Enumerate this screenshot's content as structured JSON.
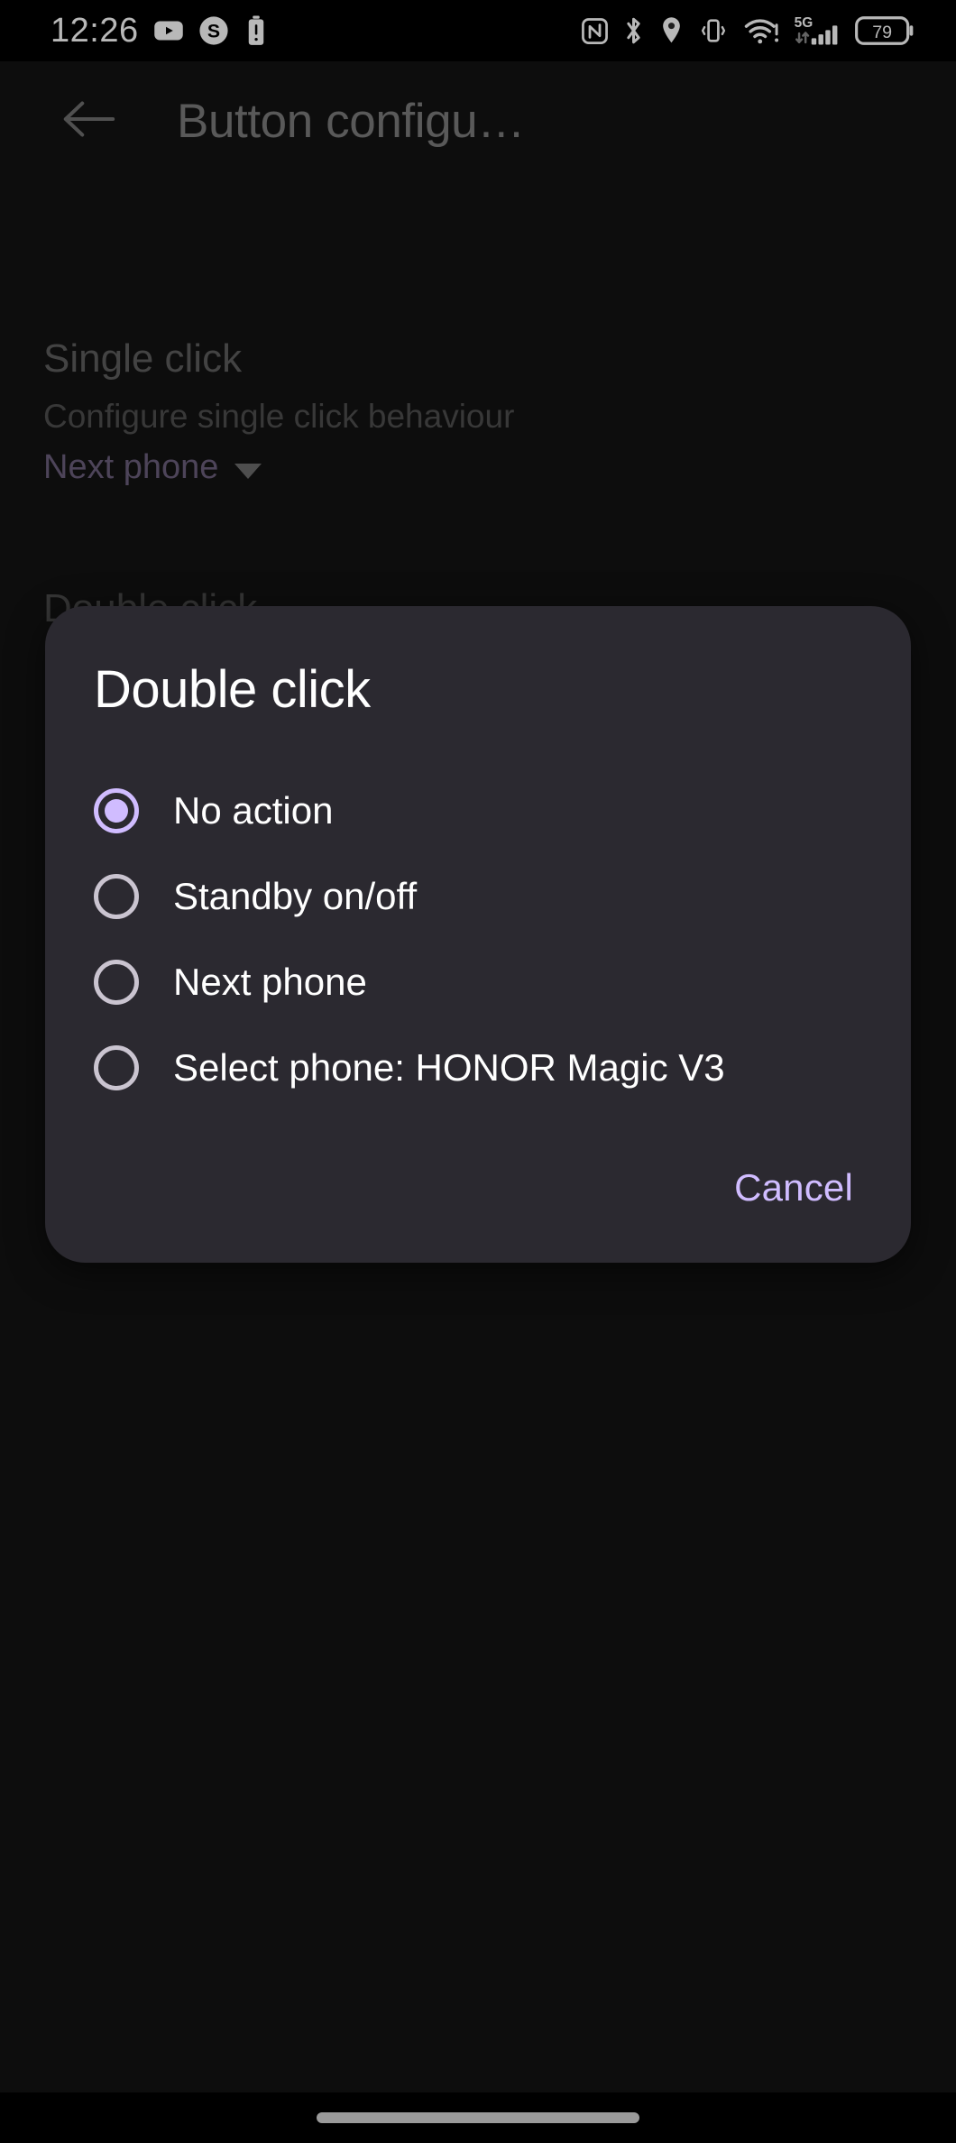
{
  "status_bar": {
    "clock": "12:26",
    "left_icons": [
      "youtube-icon",
      "skype-icon",
      "battery-alert-icon"
    ],
    "right_icons": [
      "nfc-icon",
      "bluetooth-icon",
      "location-icon",
      "vibrate-icon",
      "wifi-alert-icon",
      "mobile-signal-icon"
    ],
    "network_type": "5G",
    "battery_percent": "79"
  },
  "app_bar": {
    "back_label": "back-arrow",
    "title": "Button configu…"
  },
  "page": {
    "sections": [
      {
        "title": "Single click",
        "summary": "Configure single click behaviour",
        "value": "Next phone"
      },
      {
        "title": "Double click"
      }
    ]
  },
  "dialog": {
    "title": "Double click",
    "options": [
      {
        "label": "No action",
        "selected": true
      },
      {
        "label": "Standby on/off",
        "selected": false
      },
      {
        "label": "Next phone",
        "selected": false
      },
      {
        "label": "Select phone: HONOR Magic V3",
        "selected": false
      }
    ],
    "cancel_label": "Cancel"
  },
  "colors": {
    "accent": "#d0bcff",
    "dialog_surface": "#2b2930",
    "page_background": "#121212",
    "radio_unselected": "#cac4d0",
    "on_surface": "#ffffff"
  }
}
